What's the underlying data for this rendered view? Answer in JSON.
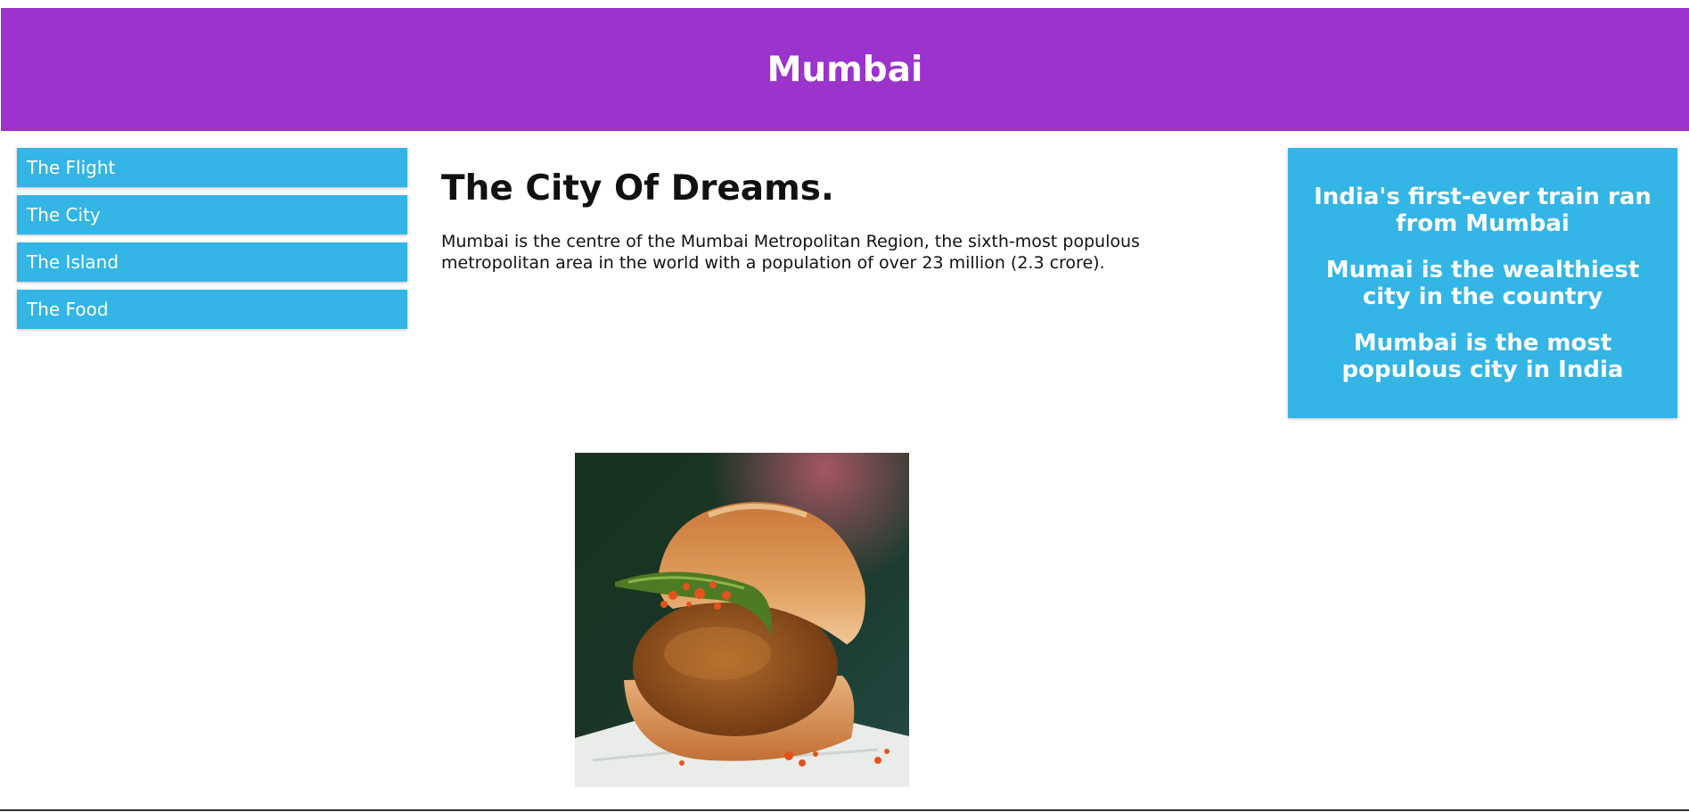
{
  "header": {
    "title": "Mumbai"
  },
  "menu": {
    "items": [
      {
        "label": "The Flight"
      },
      {
        "label": "The City"
      },
      {
        "label": "The Island"
      },
      {
        "label": "The Food"
      }
    ]
  },
  "main": {
    "heading": "The City Of Dreams.",
    "paragraph": "Mumbai is the centre of the Mumbai Metropolitan Region, the sixth-most populous metropolitan area in the world with a population of over 23 million (2.3 crore)."
  },
  "aside": {
    "facts": [
      "India's first-ever train ran from Mumbai",
      "Mumai is the wealthiest city in the country",
      "Mumbai is the most populous city in India"
    ]
  },
  "image": {
    "subject": "vada pav"
  },
  "colors": {
    "header_background": "#9b33cc",
    "accent_blue": "#33b5e5",
    "text": "#111111"
  }
}
